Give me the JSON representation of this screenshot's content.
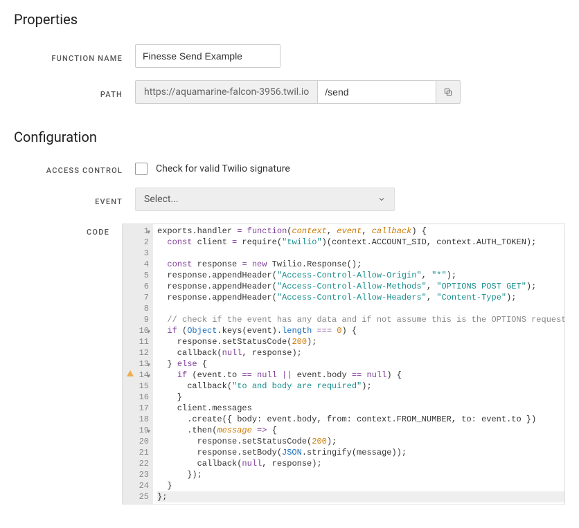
{
  "properties": {
    "heading": "Properties",
    "function_name_label": "FUNCTION NAME",
    "function_name_value": "Finesse Send Example",
    "path_label": "PATH",
    "path_base": "https://aquamarine-falcon-3956.twil.io",
    "path_value": "/send"
  },
  "configuration": {
    "heading": "Configuration",
    "access_control_label": "ACCESS CONTROL",
    "access_control_text": "Check for valid Twilio signature",
    "access_control_checked": false,
    "event_label": "EVENT",
    "event_placeholder": "Select...",
    "code_label": "CODE"
  },
  "code": {
    "lines": [
      {
        "n": 1,
        "fold": true
      },
      {
        "n": 2
      },
      {
        "n": 3
      },
      {
        "n": 4
      },
      {
        "n": 5
      },
      {
        "n": 6
      },
      {
        "n": 7
      },
      {
        "n": 8
      },
      {
        "n": 9
      },
      {
        "n": 10,
        "fold": true
      },
      {
        "n": 11
      },
      {
        "n": 12
      },
      {
        "n": 13,
        "fold": true
      },
      {
        "n": 14,
        "fold": true,
        "warn": true
      },
      {
        "n": 15
      },
      {
        "n": 16
      },
      {
        "n": 17
      },
      {
        "n": 18
      },
      {
        "n": 19,
        "fold": true
      },
      {
        "n": 20
      },
      {
        "n": 21
      },
      {
        "n": 22
      },
      {
        "n": 23
      },
      {
        "n": 24
      },
      {
        "n": 25,
        "hl": true
      }
    ],
    "source": "exports.handler = function(context, event, callback) {\n  const client = require(\"twilio\")(context.ACCOUNT_SID, context.AUTH_TOKEN);\n\n  const response = new Twilio.Response();\n  response.appendHeader(\"Access-Control-Allow-Origin\", \"*\");\n  response.appendHeader(\"Access-Control-Allow-Methods\", \"OPTIONS POST GET\");\n  response.appendHeader(\"Access-Control-Allow-Headers\", \"Content-Type\");\n\n  // check if the event has any data and if not assume this is the OPTIONS request\n  if (Object.keys(event).length === 0) {\n    response.setStatusCode(200);\n    callback(null, response);\n  } else {\n    if (event.to == null || event.body == null) {\n      callback(\"to and body are required\");\n    }\n    client.messages\n      .create({ body: event.body, from: context.FROM_NUMBER, to: event.to })\n      .then(message => {\n        response.setStatusCode(200);\n        response.setBody(JSON.stringify(message));\n        callback(null, response);\n      });\n  }\n};"
  }
}
